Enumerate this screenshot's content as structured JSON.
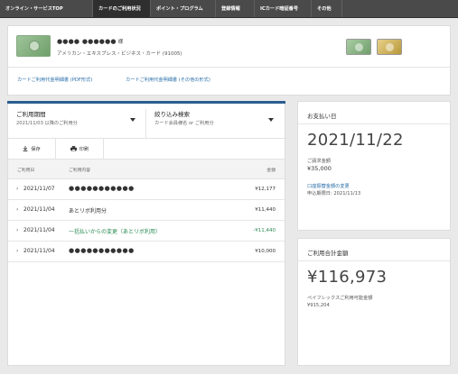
{
  "nav": {
    "tabs": [
      {
        "label": "オンライン・サービスTOP"
      },
      {
        "label": "カードのご利用状況"
      },
      {
        "label": "ポイント・プログラム"
      },
      {
        "label": "登録情報"
      },
      {
        "label": "ICカード暗証番号"
      },
      {
        "label": "その他"
      }
    ]
  },
  "card": {
    "member_name": "●●●● ●●●●●●",
    "honorific": "様",
    "card_name": "アメリカン・エキスプレス・ビジネス・カード (91005)",
    "statement_pdf": "カードご利用代金明細書 (PDF形式)",
    "statement_other": "カードご利用代金明細書 (その他の形式)"
  },
  "usage": {
    "period_label": "ご利用期間",
    "period_value": "2021/11/03 以降のご利用分",
    "filter_label": "絞り込み検索",
    "filter_sub": "カード会員様名 or ご利用分",
    "save_label": "保存",
    "print_label": "印刷",
    "col_date": "ご利用日",
    "col_desc": "ご利用内容",
    "col_amount": "金額",
    "rows": [
      {
        "date": "2021/11/07",
        "desc": "●●●●●●●●●●●",
        "amount": "¥12,177"
      },
      {
        "date": "2021/11/04",
        "desc": "あとリボ利用分",
        "amount": "¥11,440"
      },
      {
        "date": "2021/11/04",
        "desc": "一括払いからの変更（あとリボ利用）",
        "amount": "-¥11,440"
      },
      {
        "date": "2021/11/04",
        "desc": "●●●●●●●●●●●",
        "amount": "¥10,000"
      }
    ]
  },
  "payment": {
    "title": "お支払い日",
    "date": "2021/11/22",
    "billed_label": "ご請求金額",
    "billed_amount": "¥35,000",
    "change_link": "口座振替金額の変更",
    "deadline": "申込期限日: 2021/11/13"
  },
  "total": {
    "title": "ご利用合計金額",
    "amount": "¥116,973",
    "payflex_label": "ペイフレックスご利用可能金額",
    "payflex_amount": "¥915,204"
  },
  "colors": {
    "accent": "#2a5d8f",
    "link": "#2a6ea8",
    "green": "#2a8a52",
    "nav": "#4a4a4a"
  }
}
